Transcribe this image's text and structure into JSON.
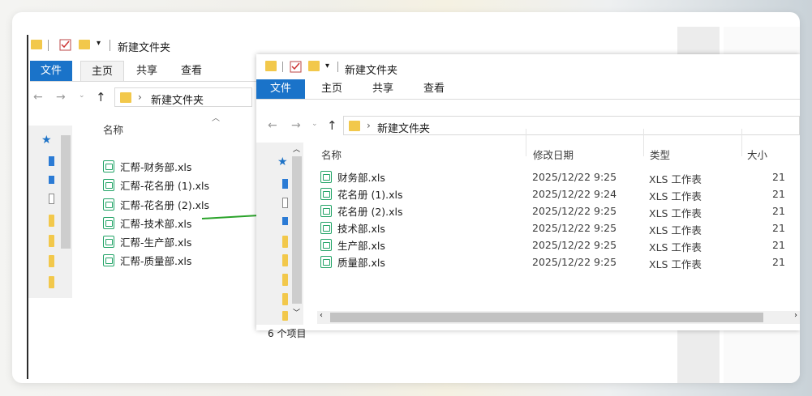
{
  "back_window": {
    "title": "新建文件夹",
    "ribbon_tabs": [
      "文件",
      "主页",
      "共享",
      "查看"
    ],
    "breadcrumb": "新建文件夹",
    "column_name": "名称",
    "files": [
      "汇帮-财务部.xls",
      "汇帮-花名册 (1).xls",
      "汇帮-花名册 (2).xls",
      "汇帮-技术部.xls",
      "汇帮-生产部.xls",
      "汇帮-质量部.xls"
    ]
  },
  "front_window": {
    "title": "新建文件夹",
    "ribbon_tabs": [
      "文件",
      "主页",
      "共享",
      "查看"
    ],
    "breadcrumb": "新建文件夹",
    "columns": {
      "name": "名称",
      "modified": "修改日期",
      "type": "类型",
      "size": "大小"
    },
    "files": [
      {
        "name": "财务部.xls",
        "modified": "2025/12/22 9:25",
        "type": "XLS 工作表",
        "size": "21"
      },
      {
        "name": "花名册 (1).xls",
        "modified": "2025/12/22 9:24",
        "type": "XLS 工作表",
        "size": "21"
      },
      {
        "name": "花名册 (2).xls",
        "modified": "2025/12/22 9:25",
        "type": "XLS 工作表",
        "size": "21"
      },
      {
        "name": "技术部.xls",
        "modified": "2025/12/22 9:25",
        "type": "XLS 工作表",
        "size": "21"
      },
      {
        "name": "生产部.xls",
        "modified": "2025/12/22 9:25",
        "type": "XLS 工作表",
        "size": "21"
      },
      {
        "name": "质量部.xls",
        "modified": "2025/12/22 9:25",
        "type": "XLS 工作表",
        "size": "21"
      }
    ],
    "status": "6 个项目"
  },
  "colors": {
    "accent": "#1a73c9",
    "excel_green": "#21a366",
    "arrow_green": "#2aa32a"
  },
  "icons": [
    "folder-icon",
    "checkbox-icon",
    "dropdown-arrow-icon",
    "back-arrow-icon",
    "forward-arrow-icon",
    "up-arrow-icon",
    "chevron-right-icon",
    "pin-icon",
    "xls-file-icon",
    "green-arrow-icon"
  ]
}
